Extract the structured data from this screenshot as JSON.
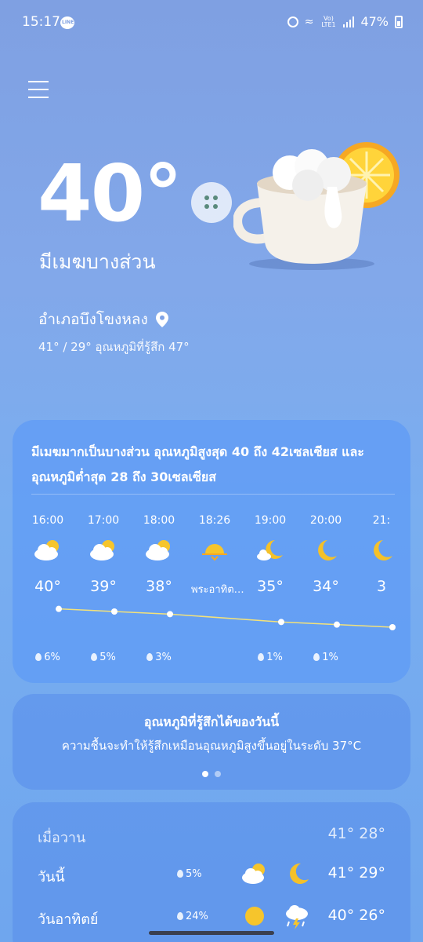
{
  "status_bar": {
    "time": "15:17",
    "line_label": "LINE",
    "network": "Vo) LTE1",
    "battery": "47%"
  },
  "current": {
    "temperature": "40°",
    "condition": "มีเมฆบางส่วน",
    "location": "อำเภอบึงโขงหลง",
    "hilo_feels": "41° / 29° อุณหภูมิที่รู้สึก 47°"
  },
  "hourly": {
    "summary": "มีเมฆมากเป็นบางส่วน อุณหภูมิสูงสุด 40 ถึง 42เซลเซียส และอุณหภูมิต่ำสุด 28 ถึง 30เซลเซียส",
    "items": [
      {
        "time": "16:00",
        "icon": "partly-cloudy-icon",
        "temp": "40°",
        "rain": "6%"
      },
      {
        "time": "17:00",
        "icon": "partly-cloudy-icon",
        "temp": "39°",
        "rain": "5%"
      },
      {
        "time": "18:00",
        "icon": "partly-cloudy-icon",
        "temp": "38°",
        "rain": "3%"
      },
      {
        "time": "18:26",
        "icon": "sunset-icon",
        "temp": "พระอาทิต…",
        "rain": ""
      },
      {
        "time": "19:00",
        "icon": "moon-cloud-icon",
        "temp": "35°",
        "rain": "1%"
      },
      {
        "time": "20:00",
        "icon": "moon-icon",
        "temp": "34°",
        "rain": "1%"
      },
      {
        "time": "21:",
        "icon": "moon-icon",
        "temp": "3",
        "rain": ""
      }
    ],
    "trend_values": [
      40,
      39,
      38,
      null,
      35,
      34,
      33
    ]
  },
  "feels": {
    "title": "อุณหภูมิที่รู้สึกได้ของวันนี้",
    "description": "ความชื้นจะทำให้รู้สึกเหมือนอุณหภูมิสูงขึ้นอยู่ในระดับ 37°C"
  },
  "daily": [
    {
      "name": "เมื่อวาน",
      "rain": "",
      "temps": "41° 28°"
    },
    {
      "name": "วันนี้",
      "rain": "5%",
      "icon_day": "partly-cloudy-icon",
      "icon_night": "moon-icon",
      "temps": "41° 29°"
    },
    {
      "name": "วันอาทิตย์",
      "rain": "24%",
      "icon_day": "sun-icon",
      "icon_night": "thunderstorm-icon",
      "temps": "40° 26°"
    }
  ],
  "colors": {
    "sun": "#f6c52c",
    "moon": "#f4c12a",
    "trend_line": "#f3e27a"
  }
}
